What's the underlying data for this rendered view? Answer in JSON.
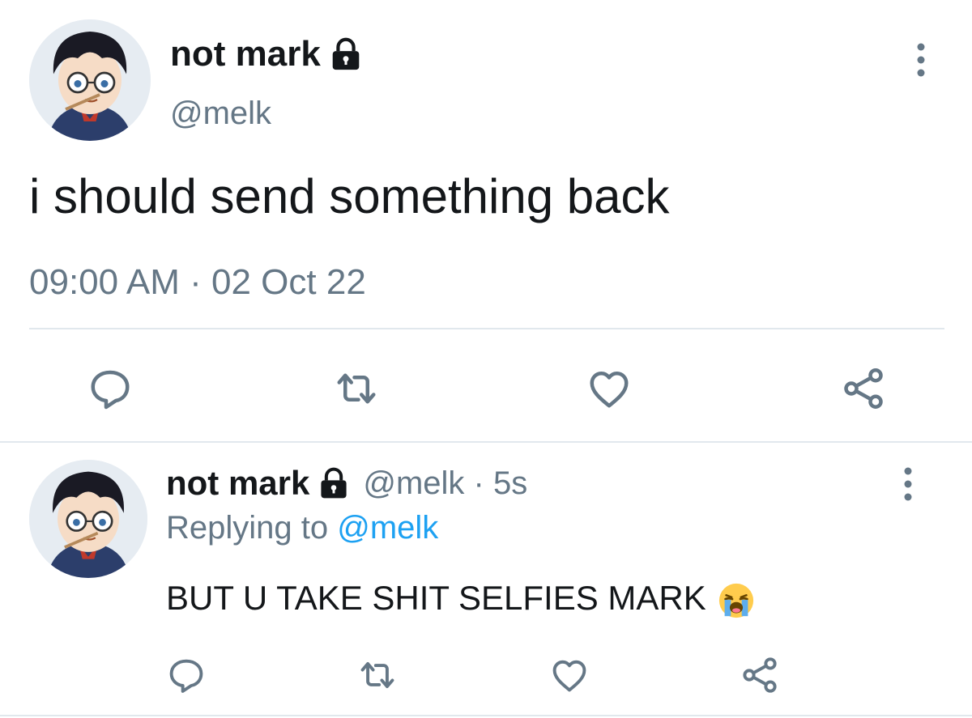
{
  "main_tweet": {
    "display_name": "not mark",
    "handle": "@melk",
    "text": "i should send something back",
    "timestamp": "09:00 AM · 02 Oct 22",
    "icons": {
      "lock": "lock-icon",
      "more": "more-vertical-icon",
      "actions": [
        "reply-icon",
        "retweet-icon",
        "like-icon",
        "share-icon"
      ]
    }
  },
  "reply_tweet": {
    "display_name": "not mark",
    "handle_time": "@melk · 5s",
    "replying_prefix": "Replying to",
    "replying_handle": "@melk",
    "text": "BUT U TAKE SHIT SELFIES MARK",
    "emoji": "loudly-crying-face-icon"
  },
  "colors": {
    "text": "#14171a",
    "secondary": "#657786",
    "link": "#1da1f2",
    "divider": "#e1e8ed"
  }
}
